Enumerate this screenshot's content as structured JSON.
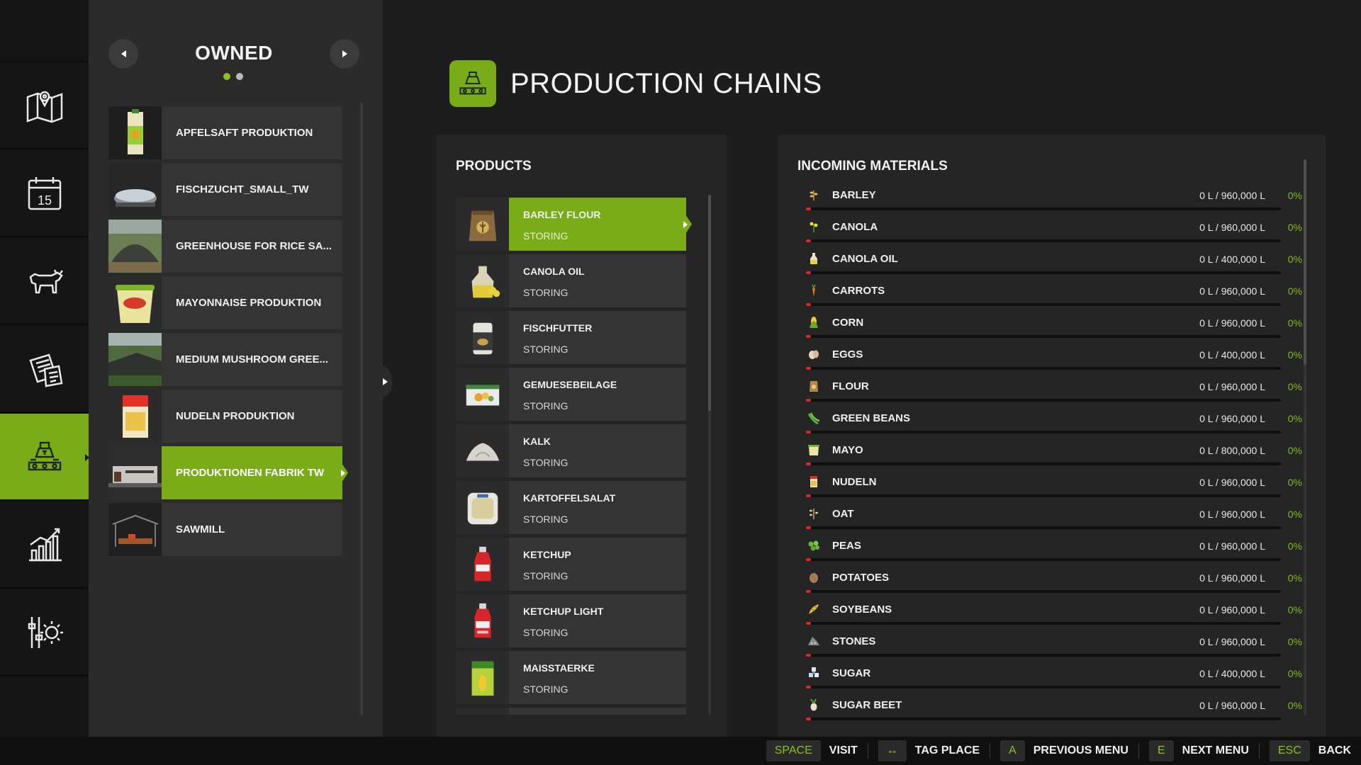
{
  "rail": {
    "items": [
      {
        "icon": "map-icon"
      },
      {
        "icon": "calendar-icon",
        "calendar_day": "15"
      },
      {
        "icon": "animals-icon"
      },
      {
        "icon": "contracts-icon"
      },
      {
        "icon": "production-icon",
        "active": true
      },
      {
        "icon": "statistics-icon"
      },
      {
        "icon": "settings-icon"
      }
    ]
  },
  "owned": {
    "title": "OWNED",
    "pages": 2,
    "current_page": 1,
    "items": [
      {
        "label": "APFELSAFT PRODUKTION"
      },
      {
        "label": "FISCHZUCHT_SMALL_TW"
      },
      {
        "label": "GREENHOUSE FOR RICE SA..."
      },
      {
        "label": "MAYONNAISE PRODUKTION"
      },
      {
        "label": "MEDIUM MUSHROOM GREE..."
      },
      {
        "label": "NUDELN PRODUKTION"
      },
      {
        "label": "PRODUKTIONEN FABRIK TW",
        "selected": true
      },
      {
        "label": "SAWMILL"
      }
    ]
  },
  "header": {
    "title": "PRODUCTION CHAINS",
    "icon": "production-chains-icon"
  },
  "products": {
    "title": "PRODUCTS",
    "items": [
      {
        "name": "BARLEY FLOUR",
        "status": "STORING",
        "selected": true
      },
      {
        "name": "CANOLA OIL",
        "status": "STORING"
      },
      {
        "name": "FISCHFUTTER",
        "status": "STORING"
      },
      {
        "name": "GEMUESEBEILAGE",
        "status": "STORING"
      },
      {
        "name": "KALK",
        "status": "STORING"
      },
      {
        "name": "KARTOFFELSALAT",
        "status": "STORING"
      },
      {
        "name": "KETCHUP",
        "status": "STORING"
      },
      {
        "name": "KETCHUP LIGHT",
        "status": "STORING"
      },
      {
        "name": "MAISSTAERKE",
        "status": "STORING"
      }
    ]
  },
  "incoming": {
    "title": "INCOMING MATERIALS",
    "items": [
      {
        "name": "BARLEY",
        "amount": "0 L / 960,000 L",
        "percent": "0%",
        "fill": 0,
        "icon": "barley-icon"
      },
      {
        "name": "CANOLA",
        "amount": "0 L / 960,000 L",
        "percent": "0%",
        "fill": 0,
        "icon": "canola-icon"
      },
      {
        "name": "CANOLA OIL",
        "amount": "0 L / 400,000 L",
        "percent": "0%",
        "fill": 0,
        "icon": "canola-oil-icon"
      },
      {
        "name": "CARROTS",
        "amount": "0 L / 960,000 L",
        "percent": "0%",
        "fill": 0,
        "icon": "carrot-icon"
      },
      {
        "name": "CORN",
        "amount": "0 L / 960,000 L",
        "percent": "0%",
        "fill": 0,
        "icon": "corn-icon"
      },
      {
        "name": "EGGS",
        "amount": "0 L / 400,000 L",
        "percent": "0%",
        "fill": 0,
        "icon": "eggs-icon"
      },
      {
        "name": "FLOUR",
        "amount": "0 L / 960,000 L",
        "percent": "0%",
        "fill": 0,
        "icon": "flour-icon"
      },
      {
        "name": "GREEN BEANS",
        "amount": "0 L / 960,000 L",
        "percent": "0%",
        "fill": 0,
        "icon": "green-beans-icon"
      },
      {
        "name": "MAYO",
        "amount": "0 L / 800,000 L",
        "percent": "0%",
        "fill": 0,
        "icon": "mayo-icon"
      },
      {
        "name": "NUDELN",
        "amount": "0 L / 960,000 L",
        "percent": "0%",
        "fill": 0,
        "icon": "noodles-icon"
      },
      {
        "name": "OAT",
        "amount": "0 L / 960,000 L",
        "percent": "0%",
        "fill": 0,
        "icon": "oat-icon"
      },
      {
        "name": "PEAS",
        "amount": "0 L / 960,000 L",
        "percent": "0%",
        "fill": 0,
        "icon": "peas-icon"
      },
      {
        "name": "POTATOES",
        "amount": "0 L / 960,000 L",
        "percent": "0%",
        "fill": 0,
        "icon": "potato-icon"
      },
      {
        "name": "SOYBEANS",
        "amount": "0 L / 960,000 L",
        "percent": "0%",
        "fill": 0,
        "icon": "soybean-icon"
      },
      {
        "name": "STONES",
        "amount": "0 L / 960,000 L",
        "percent": "0%",
        "fill": 0,
        "icon": "stones-icon"
      },
      {
        "name": "SUGAR",
        "amount": "0 L / 400,000 L",
        "percent": "0%",
        "fill": 0,
        "icon": "sugar-icon"
      },
      {
        "name": "SUGAR BEET",
        "amount": "0 L / 960,000 L",
        "percent": "0%",
        "fill": 0,
        "icon": "sugar-beet-icon"
      }
    ]
  },
  "footer": {
    "hints": [
      {
        "key": "SPACE",
        "label": "VISIT"
      },
      {
        "key": "↔",
        "label": "TAG PLACE"
      },
      {
        "key": "A",
        "label": "PREVIOUS MENU"
      },
      {
        "key": "E",
        "label": "NEXT MENU"
      },
      {
        "key": "ESC",
        "label": "BACK"
      }
    ]
  },
  "colors": {
    "accent": "#7aac1a",
    "accent_text": "#86bb1e",
    "empty_bar": "#e0262a",
    "background": "#1c1d1c"
  }
}
